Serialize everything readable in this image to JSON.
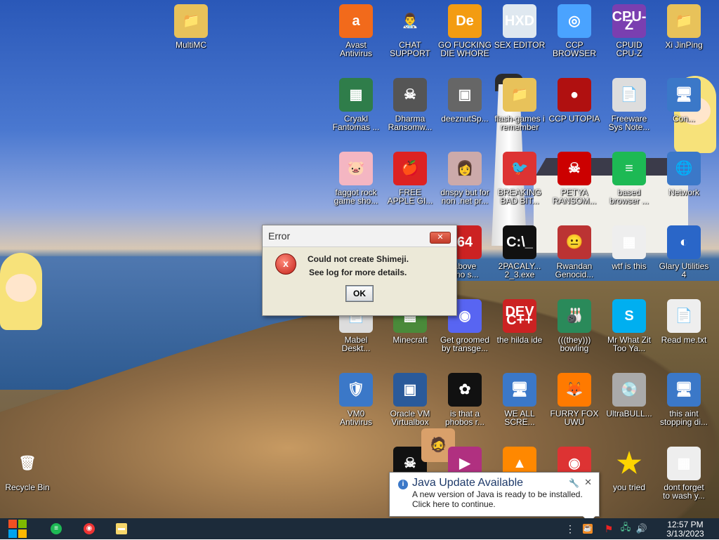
{
  "desktop": {
    "icons": [
      {
        "id": "multimc",
        "label": "MultiMC",
        "glyph": "📁",
        "color": "#e8c25a"
      },
      {
        "id": "avast",
        "label": "Avast\nAntivirus",
        "glyph": "a",
        "color": "#f26a1b"
      },
      {
        "id": "chat-support",
        "label": "CHAT\nSUPPORT",
        "glyph": "👨‍⚕️",
        "color": "transparent"
      },
      {
        "id": "go-die",
        "label": "GO FUCKING\nDIE WHORE",
        "glyph": "De",
        "color": "#f39c12"
      },
      {
        "id": "sex-editor",
        "label": "SEX EDITOR",
        "glyph": "HXD",
        "color": "#dfe8f0"
      },
      {
        "id": "ccp-browser",
        "label": "CCP\nBROWSER",
        "glyph": "◎",
        "color": "#4aa3ff"
      },
      {
        "id": "cpuid",
        "label": "CPUID\nCPU-Z",
        "glyph": "CPU-Z",
        "color": "#7a3fb0"
      },
      {
        "id": "xi-jinping",
        "label": "Xi JinPing",
        "glyph": "📁",
        "color": "#e8c25a"
      },
      {
        "id": "cryakl",
        "label": "Cryakl\nFantomas ...",
        "glyph": "▦",
        "color": "#2f7d4a"
      },
      {
        "id": "dharma",
        "label": "Dharma\nRansomw...",
        "glyph": "☠",
        "color": "#555"
      },
      {
        "id": "deeznut",
        "label": "deeznutSp...",
        "glyph": "▣",
        "color": "#666"
      },
      {
        "id": "flash-games",
        "label": "flash-games i\nremember",
        "glyph": "📁",
        "color": "#e8c25a"
      },
      {
        "id": "ccp-utopia",
        "label": "CCP UTOPIA",
        "glyph": "●",
        "color": "#b01010"
      },
      {
        "id": "freeware",
        "label": "Freeware\nSys Note...",
        "glyph": "📄",
        "color": "#ddd"
      },
      {
        "id": "con",
        "label": "Con...",
        "glyph": "🖥",
        "color": "#3b78c8"
      },
      {
        "id": "faggot-rock",
        "label": "faggot rock\ngame sho...",
        "glyph": "🐷",
        "color": "#f4b6c2"
      },
      {
        "id": "free-apple",
        "label": "FREE\nAPPLE GI...",
        "glyph": "🍎",
        "color": "#d22"
      },
      {
        "id": "dnspy",
        "label": "dnspy but for\nnon .net pr...",
        "glyph": "👩",
        "color": "#caa"
      },
      {
        "id": "breaking-bad",
        "label": "BREAKING\nBAD BIT...",
        "glyph": "🐦",
        "color": "#d33"
      },
      {
        "id": "petya",
        "label": "PETYA\nRANSOM...",
        "glyph": "☠",
        "color": "#c00"
      },
      {
        "id": "based-browser",
        "label": "based\nbrowser ...",
        "glyph": "≡",
        "color": "#1db954"
      },
      {
        "id": "network",
        "label": "Network",
        "glyph": "🌐",
        "color": "#3b78c8"
      },
      {
        "id": "above",
        "label": "above\n: no s...",
        "glyph": "64",
        "color": "#c22"
      },
      {
        "id": "2pacaly",
        "label": "2PACALY...\n2_3.exe",
        "glyph": "C:\\_",
        "color": "#111"
      },
      {
        "id": "rwandan",
        "label": "Rwandan\nGenocid...",
        "glyph": "😐",
        "color": "#b33"
      },
      {
        "id": "wtf",
        "label": "wtf is this",
        "glyph": "▦",
        "color": "#eee"
      },
      {
        "id": "glary",
        "label": "Glary Utilities\n4",
        "glyph": "◐",
        "color": "#2a66c8"
      },
      {
        "id": "mabel",
        "label": "Mabel\nDeskt...",
        "glyph": "📄",
        "color": "#ddd"
      },
      {
        "id": "minecraft",
        "label": "Minecraft",
        "glyph": "▦",
        "color": "#4a8a3a"
      },
      {
        "id": "discord",
        "label": "Get groomed\nby transge...",
        "glyph": "◉",
        "color": "#5865f2"
      },
      {
        "id": "devcpp",
        "label": "the hilda ide",
        "glyph": "DEV\nC++",
        "color": "#c22"
      },
      {
        "id": "they-bowling",
        "label": "(((they)))\nbowling",
        "glyph": "🎳",
        "color": "#2a8a5a"
      },
      {
        "id": "skype",
        "label": "Mr What Zit\nToo Ya...",
        "glyph": "S",
        "color": "#00aff0"
      },
      {
        "id": "readme",
        "label": "Read me.txt",
        "glyph": "📄",
        "color": "#eee"
      },
      {
        "id": "vm0",
        "label": "VM0\nAntivirus",
        "glyph": "🛡",
        "color": "#3b78c8"
      },
      {
        "id": "oracle-vm",
        "label": "Oracle VM\nVirtualbox",
        "glyph": "▣",
        "color": "#2a5a9a"
      },
      {
        "id": "phobos",
        "label": "is that a\nphobos r...",
        "glyph": "✿",
        "color": "#111"
      },
      {
        "id": "we-all-scre",
        "label": "WE ALL\nSCRE...",
        "glyph": "🖥",
        "color": "#3b78c8"
      },
      {
        "id": "furry-fox",
        "label": "FURRY FOX\nUWU",
        "glyph": "🦊",
        "color": "#ff7a00"
      },
      {
        "id": "ultrabull",
        "label": "UltraBULL...",
        "glyph": "💿",
        "color": "#aaa"
      },
      {
        "id": "this-aint",
        "label": "this aint\nstopping di...",
        "glyph": "🖥",
        "color": "#3b78c8"
      },
      {
        "id": "recycle-bin",
        "label": "Recycle Bin",
        "glyph": "🗑",
        "color": "transparent"
      },
      {
        "id": "skull",
        "label": "",
        "glyph": "☠",
        "color": "#111"
      },
      {
        "id": "hank",
        "label": "",
        "glyph": "🧔",
        "color": "#d9a06a"
      },
      {
        "id": "media",
        "label": "",
        "glyph": "▶",
        "color": "#b03080"
      },
      {
        "id": "vlc",
        "label": "",
        "glyph": "▲",
        "color": "#ff8800"
      },
      {
        "id": "chrome",
        "label": "",
        "glyph": "◉",
        "color": "#d33"
      },
      {
        "id": "you-tried",
        "label": "you tried",
        "glyph": "★",
        "color": "transparent"
      },
      {
        "id": "dont-forget",
        "label": "dont forget\nto wash y...",
        "glyph": "▦",
        "color": "#eee"
      }
    ]
  },
  "error_dialog": {
    "title": "Error",
    "close_glyph": "✕",
    "icon_glyph": "x",
    "line1": "Could not create Shimeji.",
    "line2": "See log for more details.",
    "ok_label": "OK"
  },
  "java_notification": {
    "title": "Java Update Available",
    "line1": "A new version of Java is ready to be installed.",
    "line2": "Click here to continue.",
    "info_glyph": "i",
    "close_glyph": "✕",
    "settings_glyph": "🔧"
  },
  "taskbar": {
    "pinned": [
      {
        "id": "spotify",
        "glyph": "≡",
        "color": "#1db954"
      },
      {
        "id": "chrome",
        "glyph": "◉",
        "color": "#e33"
      },
      {
        "id": "explorer",
        "glyph": "▬",
        "color": "#f5d66a"
      }
    ],
    "tray": {
      "overflow_glyph": "⋮",
      "java_glyph": "☕",
      "flag_glyph": "⚑",
      "network_glyph": "🖧",
      "volume_glyph": "🔊"
    },
    "clock": {
      "time": "12:57 PM",
      "date": "3/13/2023"
    },
    "start_colors": [
      "#f25022",
      "#7fba00",
      "#00a4ef",
      "#ffb900"
    ]
  }
}
